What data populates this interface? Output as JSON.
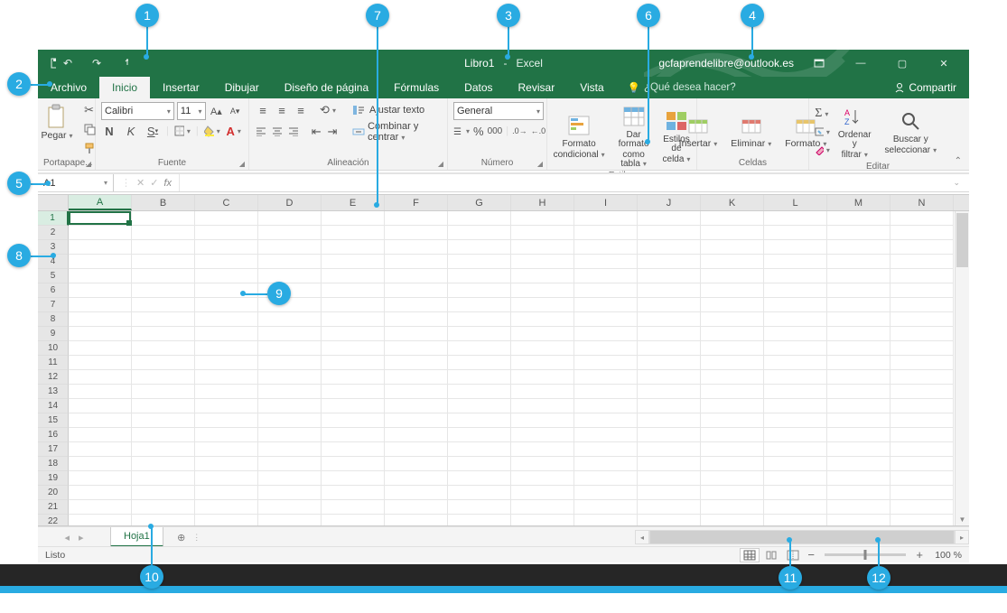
{
  "annotations": [
    "1",
    "2",
    "3",
    "4",
    "5",
    "6",
    "7",
    "8",
    "9",
    "10",
    "11",
    "12"
  ],
  "titlebar": {
    "doc_name": "Libro1",
    "app_name": "Excel",
    "account_email": "gcfaprendelibre@outlook.es"
  },
  "tabs": {
    "file": "Archivo",
    "items": [
      "Inicio",
      "Insertar",
      "Dibujar",
      "Diseño de página",
      "Fórmulas",
      "Datos",
      "Revisar",
      "Vista"
    ],
    "active_index": 0,
    "tell_me": "¿Qué desea hacer?",
    "share": "Compartir"
  },
  "ribbon": {
    "clipboard": {
      "paste": "Pegar",
      "label": "Portapape..."
    },
    "font": {
      "name": "Calibri",
      "size": "11",
      "bold": "N",
      "italic": "K",
      "underline": "S",
      "label": "Fuente"
    },
    "alignment": {
      "wrap": "Ajustar texto",
      "merge": "Combinar y centrar",
      "label": "Alineación"
    },
    "number": {
      "format": "General",
      "label": "Número"
    },
    "styles": {
      "cond": "Formato condicional",
      "table": "Dar formato como tabla",
      "cell": "Estilos de celda",
      "label": "Estilos"
    },
    "cells": {
      "insert": "Insertar",
      "delete": "Eliminar",
      "format": "Formato",
      "label": "Celdas"
    },
    "editing": {
      "sortfilter": "Ordenar y filtrar",
      "findselect": "Buscar y seleccionar",
      "label": "Editar"
    }
  },
  "formula_row": {
    "namebox": "A1",
    "fx": "fx"
  },
  "grid": {
    "columns": [
      "A",
      "B",
      "C",
      "D",
      "E",
      "F",
      "G",
      "H",
      "I",
      "J",
      "K",
      "L",
      "M",
      "N"
    ],
    "rows": [
      "1",
      "2",
      "3",
      "4",
      "5",
      "6",
      "7",
      "8",
      "9",
      "10",
      "11",
      "12",
      "13",
      "14",
      "15",
      "16",
      "17",
      "18",
      "19",
      "20",
      "21",
      "22"
    ],
    "active_cell": "A1"
  },
  "sheet_tabs": {
    "active": "Hoja1"
  },
  "statusbar": {
    "ready": "Listo",
    "zoom_label": "100 %"
  }
}
